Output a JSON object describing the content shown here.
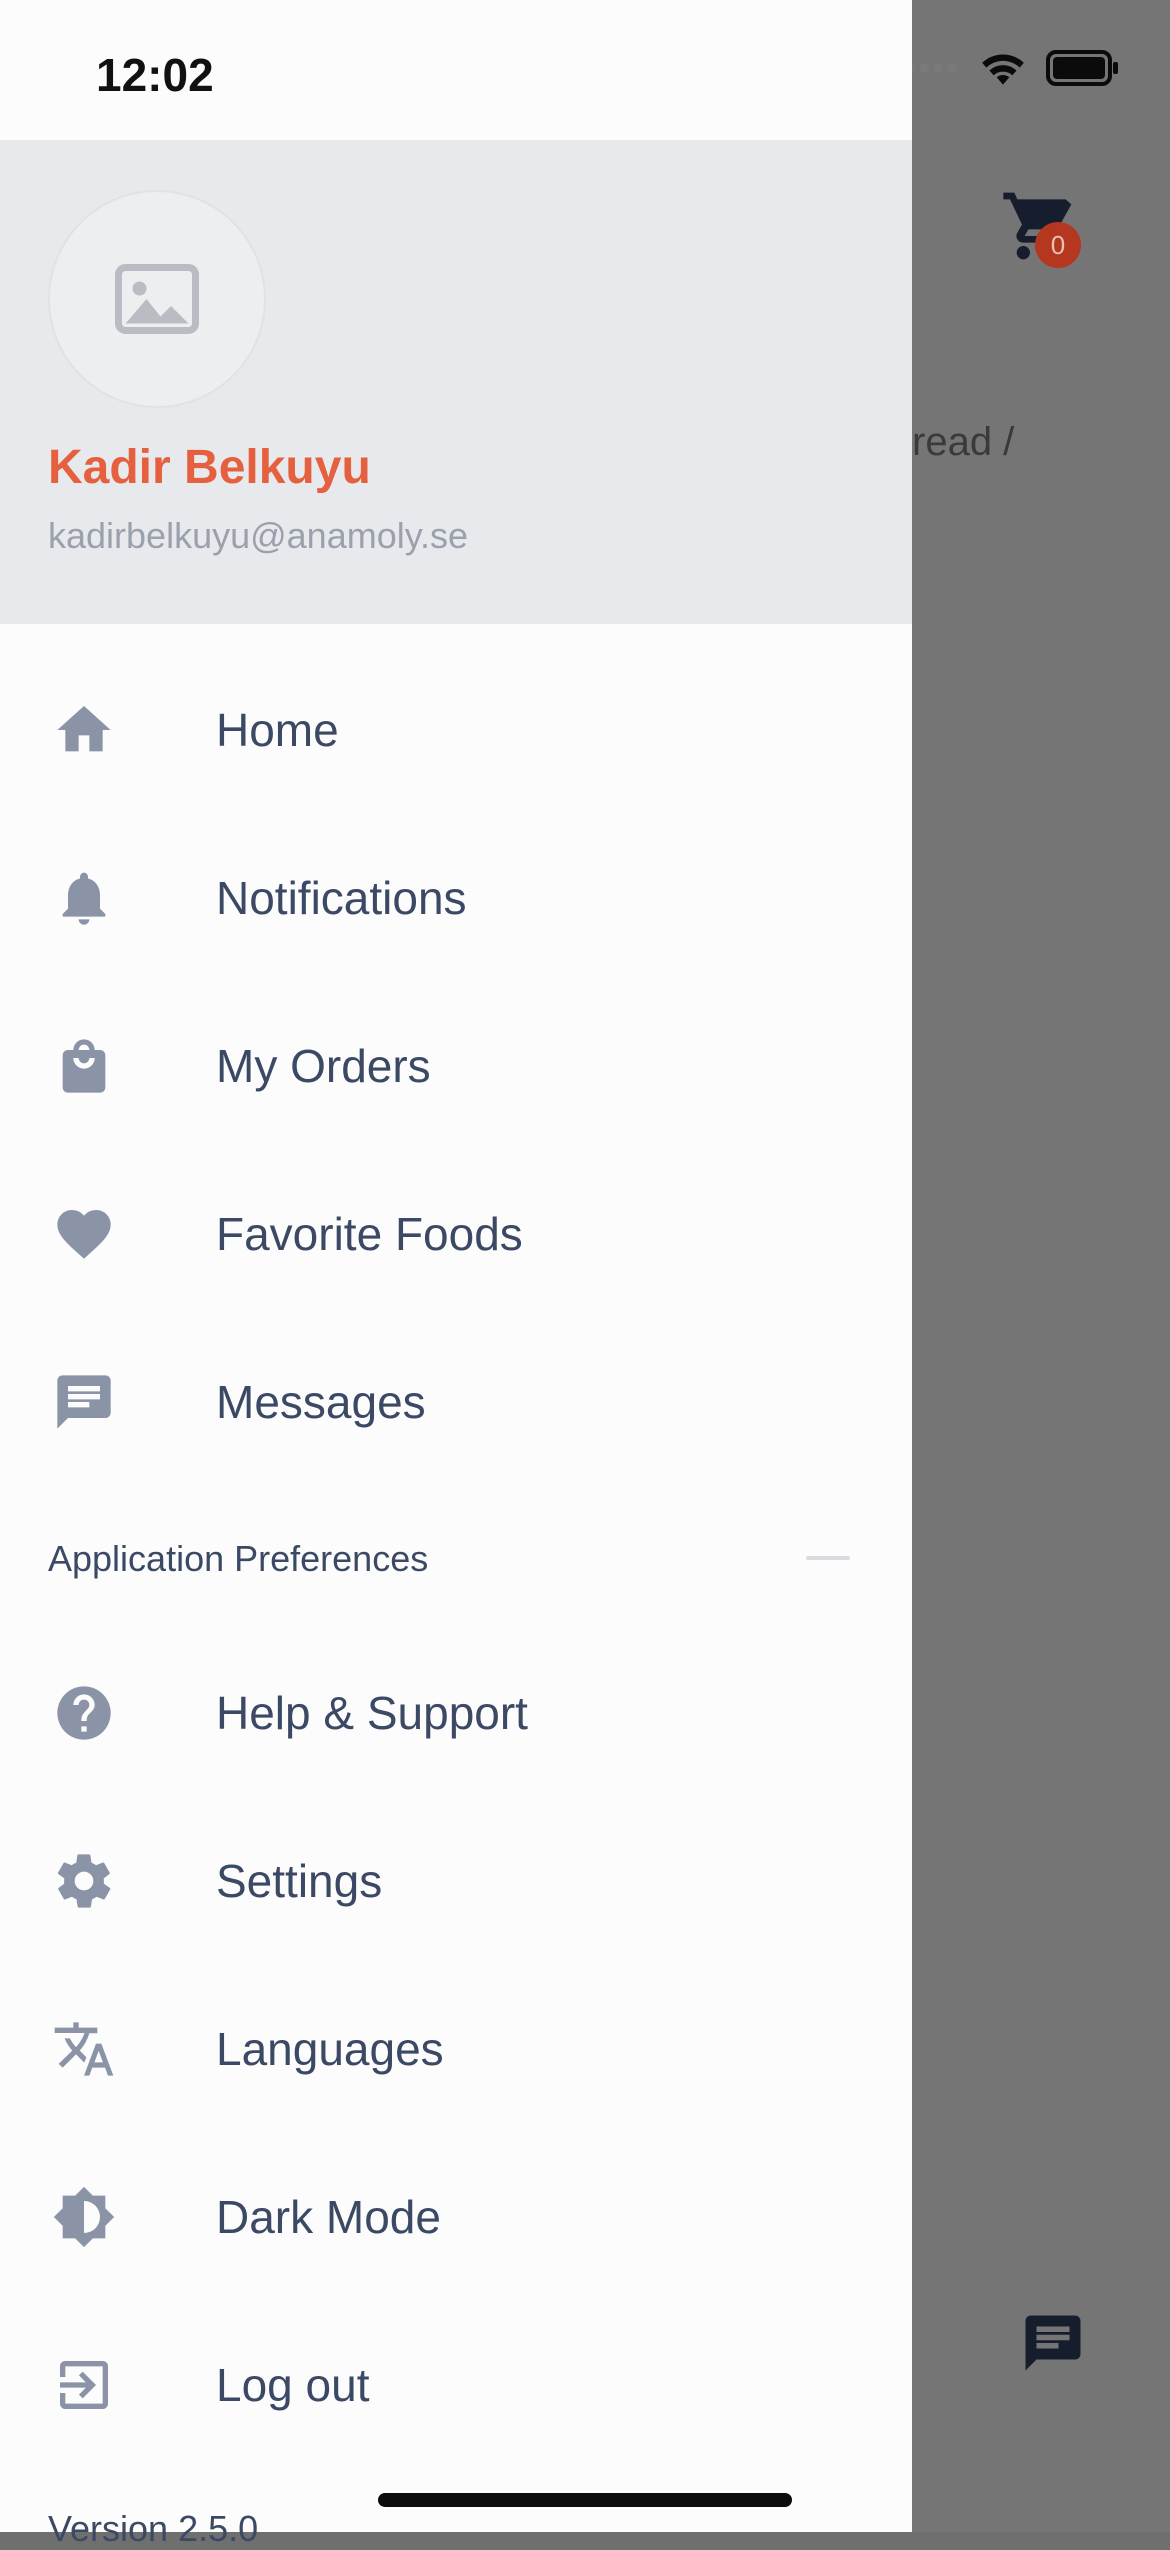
{
  "status_bar": {
    "time": "12:02"
  },
  "background_app": {
    "cart_count": "0",
    "breadcrumb_fragment": "read /"
  },
  "drawer": {
    "user": {
      "name": "Kadir Belkuyu",
      "email": "kadirbelkuyu@anamoly.se"
    },
    "menu_items": [
      {
        "label": "Home",
        "icon": "home-icon"
      },
      {
        "label": "Notifications",
        "icon": "bell-icon"
      },
      {
        "label": "My Orders",
        "icon": "shopping-bag-icon"
      },
      {
        "label": "Favorite Foods",
        "icon": "heart-icon"
      },
      {
        "label": "Messages",
        "icon": "chat-icon"
      }
    ],
    "preferences_section": {
      "title": "Application Preferences",
      "items": [
        {
          "label": "Help & Support",
          "icon": "help-icon"
        },
        {
          "label": "Settings",
          "icon": "gear-icon"
        },
        {
          "label": "Languages",
          "icon": "translate-icon"
        },
        {
          "label": "Dark Mode",
          "icon": "brightness-icon"
        },
        {
          "label": "Log out",
          "icon": "logout-icon"
        }
      ]
    },
    "version_label": "Version 2.5.0"
  },
  "colors": {
    "accent": "#e4603f",
    "menu_text": "#3b4965",
    "icon": "#8a94a6",
    "header_bg": "#e8e9ec"
  }
}
